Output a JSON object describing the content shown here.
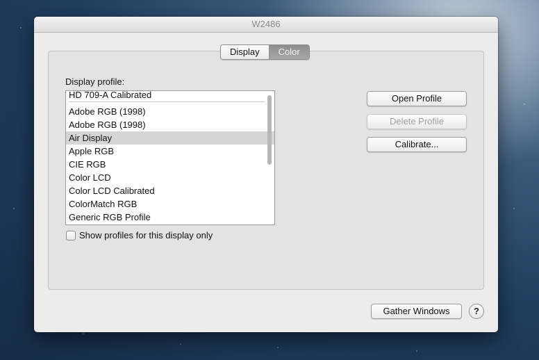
{
  "window": {
    "title": "W2486"
  },
  "tabs": [
    {
      "label": "Display",
      "selected": false
    },
    {
      "label": "Color",
      "selected": true
    }
  ],
  "profile_section": {
    "label": "Display profile:",
    "items": [
      "HD 709-A Calibrated",
      "Adobe RGB (1998)",
      "Adobe RGB (1998)",
      "Air Display",
      "Apple RGB",
      "CIE RGB",
      "Color LCD",
      "Color LCD Calibrated",
      "ColorMatch RGB",
      "Generic RGB Profile"
    ],
    "selected_item": "Air Display"
  },
  "checkbox": {
    "label": "Show profiles for this display only",
    "checked": false
  },
  "buttons": {
    "open_profile": "Open Profile",
    "delete_profile": "Delete Profile",
    "calibrate": "Calibrate...",
    "gather_windows": "Gather Windows",
    "help": "?"
  },
  "colors": {
    "selected_tab": "#9a9a9a",
    "selected_row": "#d6d6d6",
    "window_bg": "#ececec"
  }
}
